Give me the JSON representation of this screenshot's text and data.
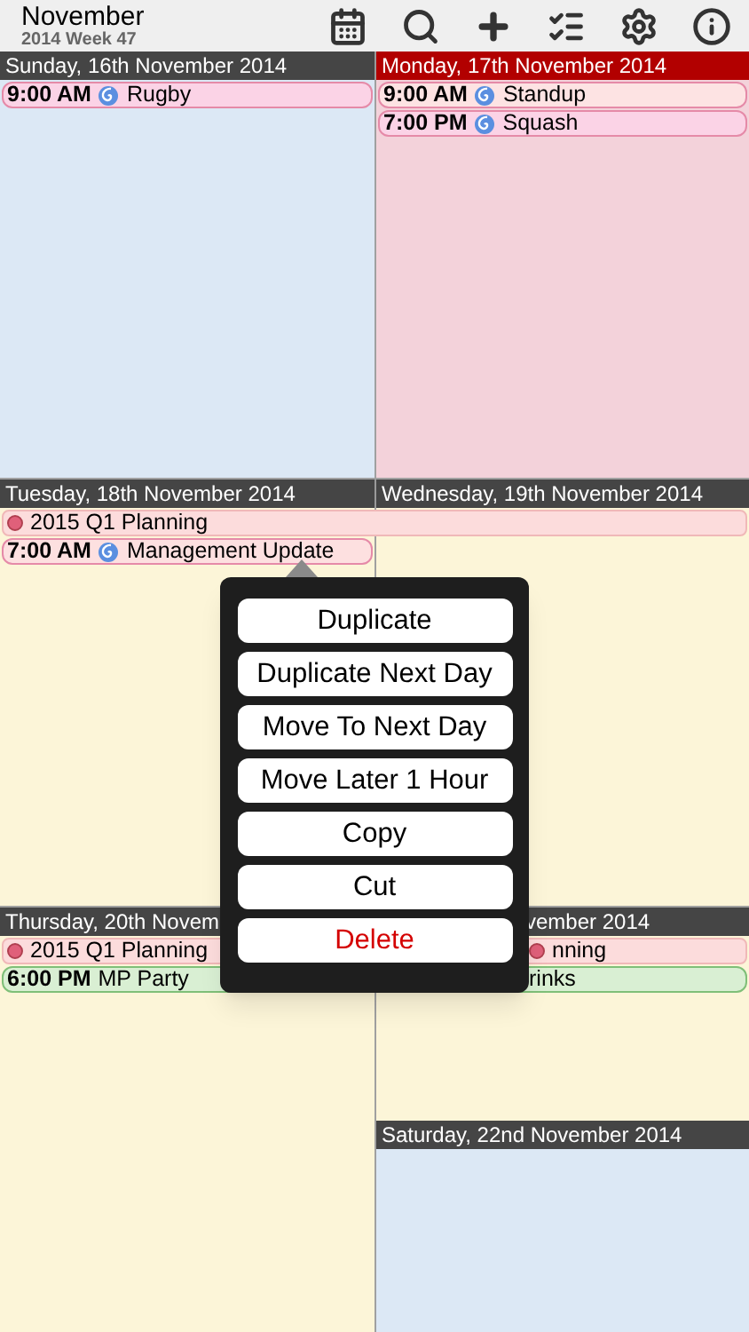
{
  "header": {
    "month": "November",
    "week": "2014 Week 47"
  },
  "rows": [
    {
      "kind": "pair",
      "days": [
        {
          "title": "Sunday, 16th November 2014",
          "today": false,
          "weekend": true,
          "events": [
            {
              "kind": "timed",
              "time": "9:00 AM",
              "title": "Rugby",
              "recurring": true,
              "color": "#fbd3e6"
            }
          ]
        },
        {
          "title": "Monday, 17th November 2014",
          "today": true,
          "weekend": false,
          "events": [
            {
              "kind": "timed",
              "time": "9:00 AM",
              "title": "Standup",
              "recurring": true,
              "color": "#fde3e3"
            },
            {
              "kind": "timed",
              "time": "7:00 PM",
              "title": "Squash",
              "recurring": true,
              "color": "#fbd3e6"
            }
          ]
        }
      ]
    },
    {
      "kind": "pair",
      "spanning": [
        {
          "kind": "allday",
          "title": "2015 Q1 Planning",
          "color": "#fcdcdc"
        }
      ],
      "days": [
        {
          "title": "Tuesday, 18th November 2014",
          "today": false,
          "weekend": false,
          "events": [
            {
              "kind": "timed",
              "time": "7:00 AM",
              "title": "Management Update",
              "recurring": true,
              "color": "#fde0e0"
            }
          ]
        },
        {
          "title": "Wednesday, 19th November 2014",
          "today": false,
          "weekend": false
        }
      ]
    },
    {
      "kind": "split",
      "days": [
        {
          "title": "Thursday, 20th Novem",
          "today": false,
          "weekend": false,
          "events": [
            {
              "kind": "allday",
              "title": "2015 Q1 Planning",
              "color": "#fcdcdc"
            },
            {
              "kind": "timed",
              "time": "6:00 PM",
              "title": "MP Party",
              "recurring": false,
              "color": "#d9efd3"
            }
          ]
        },
        {
          "title": "vember 2014",
          "today": false,
          "weekend": false,
          "events": [
            {
              "kind": "allday",
              "title": "nning",
              "color": "#fcdcdc"
            },
            {
              "kind": "timed",
              "title": "rinks",
              "recurring": false,
              "color": "#d9efd3"
            }
          ]
        },
        {
          "title": "Saturday, 22nd November 2014",
          "today": false,
          "weekend": true
        }
      ]
    }
  ],
  "menu": [
    {
      "label": "Duplicate",
      "kind": "normal"
    },
    {
      "label": "Duplicate Next Day",
      "kind": "normal"
    },
    {
      "label": "Move To Next Day",
      "kind": "normal"
    },
    {
      "label": "Move Later 1 Hour",
      "kind": "normal"
    },
    {
      "label": "Copy",
      "kind": "normal"
    },
    {
      "label": "Cut",
      "kind": "normal"
    },
    {
      "label": "Delete",
      "kind": "danger"
    }
  ]
}
